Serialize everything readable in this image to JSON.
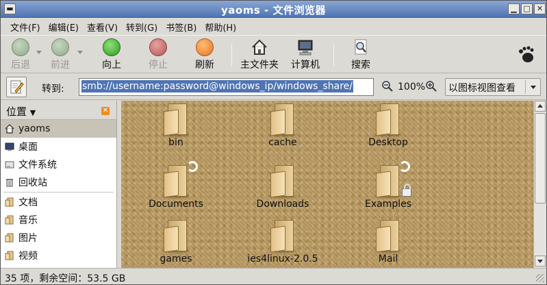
{
  "window": {
    "title": "yaoms - 文件浏览器"
  },
  "menu": [
    "文件(F)",
    "编辑(E)",
    "查看(V)",
    "转到(G)",
    "书签(B)",
    "帮助(H)"
  ],
  "toolbar": {
    "back": "后退",
    "forward": "前进",
    "up": "向上",
    "stop": "停止",
    "reload": "刷新",
    "home": "主文件夹",
    "computer": "计算机",
    "search": "搜索"
  },
  "location": {
    "goto_label": "转到:",
    "path": "smb://username:password@windows_ip/windows_share/",
    "zoom": "100%",
    "view_mode": "以图标视图查看"
  },
  "sidebar": {
    "title": "位置",
    "places": [
      {
        "label": "yaoms",
        "icon": "home-icon",
        "selected": true
      },
      {
        "label": "桌面",
        "icon": "desktop-icon"
      },
      {
        "label": "文件系统",
        "icon": "drive-icon"
      },
      {
        "label": "回收站",
        "icon": "trash-icon"
      }
    ],
    "bookmarks": [
      {
        "label": "文档",
        "icon": "folder-icon"
      },
      {
        "label": "音乐",
        "icon": "folder-icon"
      },
      {
        "label": "图片",
        "icon": "folder-icon"
      },
      {
        "label": "视频",
        "icon": "folder-icon"
      }
    ]
  },
  "files": [
    {
      "name": "bin"
    },
    {
      "name": "cache"
    },
    {
      "name": "Desktop"
    },
    {
      "name": "Documents",
      "emblem": "link"
    },
    {
      "name": "Downloads"
    },
    {
      "name": "Examples",
      "emblem": "link-lock"
    },
    {
      "name": "games"
    },
    {
      "name": "ies4linux-2.0.5"
    },
    {
      "name": "Mail"
    }
  ],
  "status": {
    "text": "35 项，剩余空间：53.5 GB"
  }
}
